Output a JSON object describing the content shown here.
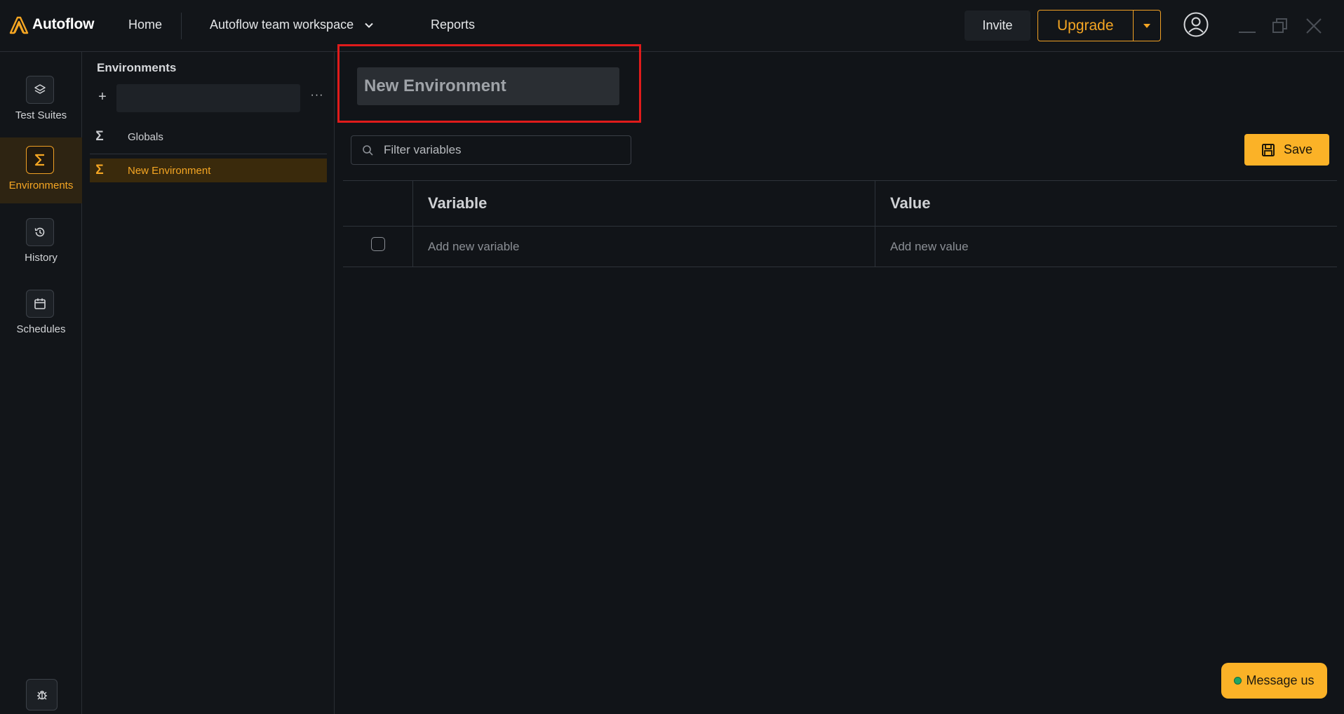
{
  "app": {
    "name": "Autoflow",
    "accent_color": "#f5a623",
    "highlight_color": "#e01b1b"
  },
  "topbar": {
    "home_label": "Home",
    "workspace_label": "Autoflow team workspace",
    "reports_label": "Reports",
    "invite_label": "Invite",
    "upgrade_label": "Upgrade"
  },
  "rail": {
    "items": [
      {
        "label": "Test Suites",
        "icon": "layers-icon"
      },
      {
        "label": "Environments",
        "icon": "sigma-icon",
        "active": true
      },
      {
        "label": "History",
        "icon": "history-icon"
      },
      {
        "label": "Schedules",
        "icon": "calendar-icon"
      }
    ],
    "bottom_icon": "bug-icon"
  },
  "env_panel": {
    "title": "Environments",
    "add_label": "+",
    "more_label": "···",
    "search_value": "",
    "items": [
      {
        "label": "Globals",
        "icon": "Σ"
      },
      {
        "label": "New Environment",
        "icon": "Σ",
        "active": true
      }
    ]
  },
  "main": {
    "env_name_value": "New Environment",
    "filter_placeholder": "Filter variables",
    "save_label": "Save",
    "table": {
      "headers": [
        "Variable",
        "Value"
      ],
      "new_variable_placeholder": "Add new variable",
      "new_value_placeholder": "Add new value"
    }
  },
  "chat": {
    "label": "Message us"
  }
}
